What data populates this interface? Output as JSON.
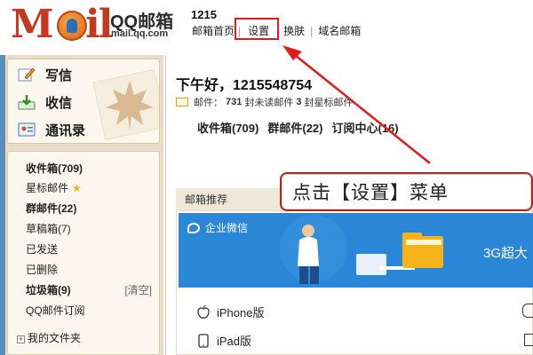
{
  "header": {
    "logo_m": "M",
    "logo_il": "il",
    "brand_name": "QQ邮箱",
    "brand_url": "mail.qq.com",
    "account": "1215",
    "nav": [
      "邮箱首页",
      "设置",
      "换肤",
      "域名邮箱"
    ],
    "nav_sep": "|",
    "nav_sep2": "-"
  },
  "compose": {
    "items": [
      {
        "icon": "write-icon",
        "label": "写信"
      },
      {
        "icon": "inbox-download-icon",
        "label": "收信"
      },
      {
        "icon": "contacts-icon",
        "label": "通讯录"
      }
    ]
  },
  "folders": [
    {
      "label": "收件箱(709)",
      "bold": true
    },
    {
      "label": "星标邮件",
      "star": true
    },
    {
      "label": "群邮件(22)",
      "bold": true
    },
    {
      "label": "草稿箱(7)"
    },
    {
      "label": "已发送"
    },
    {
      "label": "已删除"
    },
    {
      "label": "垃圾箱(9)",
      "bold": true,
      "right": "[清空]"
    },
    {
      "label": "QQ邮件订阅"
    }
  ],
  "tree": {
    "my_folders": "我的文件夹",
    "plus": "+"
  },
  "main": {
    "greeting": "下午好，1215548754",
    "mail_prefix": "邮件：",
    "unread_count": "731",
    "unread_text": "封未读邮件",
    "starred_count": "3",
    "starred_text": "封星标邮件",
    "quick_links": [
      "收件箱(709)",
      "群邮件(22)",
      "订阅中心(16)"
    ]
  },
  "recommend": {
    "title": "邮箱推荐",
    "banner_label": "企业微信",
    "banner_right": "3G超大",
    "apps": [
      {
        "icon": "apple-icon",
        "label": "iPhone版"
      },
      {
        "icon": "ipad-icon",
        "label": "iPad版"
      }
    ]
  },
  "callout": {
    "text": "点击【设置】菜单"
  },
  "colors": {
    "logo_red": "#c23a22",
    "highlight_red": "#e21a1a",
    "sidebar_bg": "#e9ddc8",
    "banner_blue": "#2a86d6"
  }
}
